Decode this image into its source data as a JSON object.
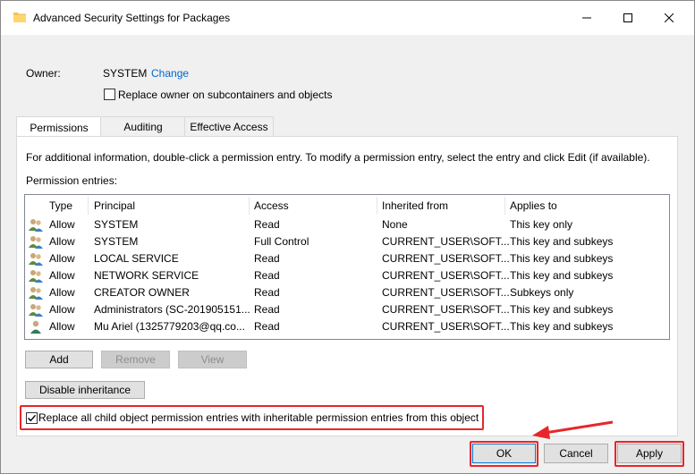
{
  "window": {
    "title": "Advanced Security Settings for Packages",
    "controls": {
      "minimize": "—",
      "maximize": "☐",
      "close": "✕"
    }
  },
  "owner": {
    "label": "Owner:",
    "value": "SYSTEM",
    "change_link": "Change",
    "replace_owner_label": "Replace owner on subcontainers and objects",
    "replace_owner_checked": false
  },
  "tabs": [
    {
      "label": "Permissions",
      "active": true
    },
    {
      "label": "Auditing",
      "active": false
    },
    {
      "label": "Effective Access",
      "active": false
    }
  ],
  "permissions": {
    "info": "For additional information, double-click a permission entry. To modify a permission entry, select the entry and click Edit (if available).",
    "entries_label": "Permission entries:",
    "columns": [
      "Type",
      "Principal",
      "Access",
      "Inherited from",
      "Applies to"
    ],
    "rows": [
      {
        "icon": "group-icon",
        "type": "Allow",
        "principal": "SYSTEM",
        "access": "Read",
        "inherited": "None",
        "applies": "This key only"
      },
      {
        "icon": "group-icon",
        "type": "Allow",
        "principal": "SYSTEM",
        "access": "Full Control",
        "inherited": "CURRENT_USER\\SOFT...",
        "applies": "This key and subkeys"
      },
      {
        "icon": "group-icon",
        "type": "Allow",
        "principal": "LOCAL SERVICE",
        "access": "Read",
        "inherited": "CURRENT_USER\\SOFT...",
        "applies": "This key and subkeys"
      },
      {
        "icon": "group-icon",
        "type": "Allow",
        "principal": "NETWORK SERVICE",
        "access": "Read",
        "inherited": "CURRENT_USER\\SOFT...",
        "applies": "This key and subkeys"
      },
      {
        "icon": "group-icon",
        "type": "Allow",
        "principal": "CREATOR OWNER",
        "access": "Read",
        "inherited": "CURRENT_USER\\SOFT...",
        "applies": "Subkeys only"
      },
      {
        "icon": "group-icon",
        "type": "Allow",
        "principal": "Administrators (SC-201905151...",
        "access": "Read",
        "inherited": "CURRENT_USER\\SOFT...",
        "applies": "This key and subkeys"
      },
      {
        "icon": "user-icon",
        "type": "Allow",
        "principal": "Mu Ariel (1325779203@qq.co...",
        "access": "Read",
        "inherited": "CURRENT_USER\\SOFT...",
        "applies": "This key and subkeys"
      }
    ],
    "buttons": {
      "add": "Add",
      "remove": "Remove",
      "view": "View"
    },
    "disable_inheritance": "Disable inheritance",
    "replace_child_label": "Replace all child object permission entries with inheritable permission entries from this object",
    "replace_child_checked": true
  },
  "footer": {
    "ok": "OK",
    "cancel": "Cancel",
    "apply": "Apply"
  },
  "colors": {
    "highlight": "#e8262a",
    "link": "#0066cc",
    "accent": "#0078d7"
  }
}
